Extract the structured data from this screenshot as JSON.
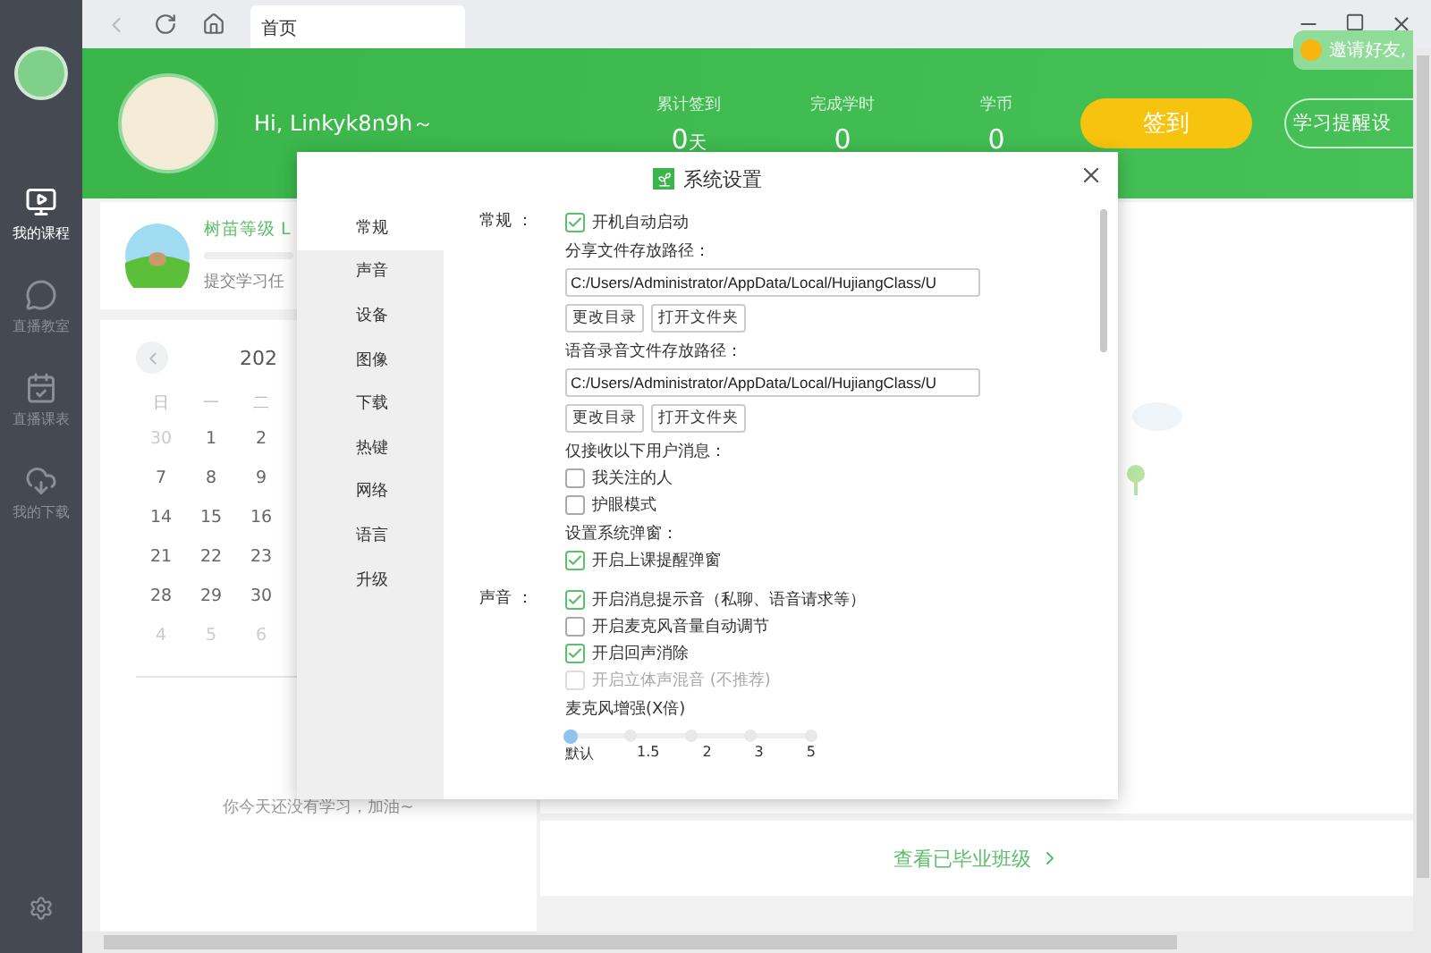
{
  "sidebar": {
    "items": [
      {
        "label": "我的课程",
        "selected": true
      },
      {
        "label": "直播教室",
        "selected": false
      },
      {
        "label": "直播课表",
        "selected": false
      },
      {
        "label": "我的下载",
        "selected": false
      }
    ]
  },
  "toolbar": {
    "tab": "首页"
  },
  "banner": {
    "greeting": "Hi, Linkyk8n9h～",
    "invite": "邀请好友,",
    "stats": [
      {
        "label": "累计签到",
        "value": "0",
        "unit": "天"
      },
      {
        "label": "完成学时",
        "value": "0"
      },
      {
        "label": "学币",
        "value": "0"
      }
    ],
    "checkin_button": "签到",
    "reminder_button": "学习提醒设"
  },
  "level_card": {
    "title": "树苗等级 L",
    "level": 0,
    "subtitle": "提交学习任"
  },
  "calendar": {
    "year": "202",
    "weekdays": [
      "日",
      "一",
      "二"
    ],
    "weeks": [
      [
        {
          "day": "30",
          "muted": true
        },
        {
          "day": "1",
          "muted": false
        },
        {
          "day": "2",
          "muted": false
        }
      ],
      [
        {
          "day": "7",
          "muted": false
        },
        {
          "day": "8",
          "muted": false
        },
        {
          "day": "9",
          "muted": false
        }
      ],
      [
        {
          "day": "14",
          "muted": false
        },
        {
          "day": "15",
          "muted": false
        },
        {
          "day": "16",
          "muted": false
        }
      ],
      [
        {
          "day": "21",
          "muted": false
        },
        {
          "day": "22",
          "muted": false
        },
        {
          "day": "23",
          "muted": false
        }
      ],
      [
        {
          "day": "28",
          "muted": false
        },
        {
          "day": "29",
          "muted": false
        },
        {
          "day": "30",
          "muted": false
        }
      ],
      [
        {
          "day": "4",
          "muted": true
        },
        {
          "day": "5",
          "muted": true
        },
        {
          "day": "6",
          "muted": true
        }
      ]
    ]
  },
  "empty_state": "你今天还没有学习，加油~",
  "graduated_link": "查看已毕业班级",
  "dialog": {
    "title": "系统设置",
    "nav": [
      {
        "label": "常规",
        "selected": true
      },
      {
        "label": "声音",
        "selected": false
      },
      {
        "label": "设备",
        "selected": false
      },
      {
        "label": "图像",
        "selected": false
      },
      {
        "label": "下载",
        "selected": false
      },
      {
        "label": "热键",
        "selected": false
      },
      {
        "label": "网络",
        "selected": false
      },
      {
        "label": "语言",
        "selected": false
      },
      {
        "label": "升级",
        "selected": false
      }
    ],
    "sections": [
      {
        "label": "常规 ：",
        "items": [
          {
            "kind": "checkbox",
            "label": "开机自动启动",
            "checked": true,
            "disabled": false
          },
          {
            "kind": "path",
            "label": "分享文件存放路径：",
            "value": "C:/Users/Administrator/AppData/Local/HujiangClass/U",
            "buttons": [
              "更改目录",
              "打开文件夹"
            ]
          },
          {
            "kind": "path",
            "label": "语音录音文件存放路径：",
            "value": "C:/Users/Administrator/AppData/Local/HujiangClass/U",
            "buttons": [
              "更改目录",
              "打开文件夹"
            ]
          },
          {
            "kind": "heading",
            "label": "仅接收以下用户消息："
          },
          {
            "kind": "checkbox",
            "label": "我关注的人",
            "checked": false,
            "disabled": false
          },
          {
            "kind": "checkbox",
            "label": "护眼模式",
            "checked": false,
            "disabled": false
          },
          {
            "kind": "heading",
            "label": "设置系统弹窗："
          },
          {
            "kind": "checkbox",
            "label": "开启上课提醒弹窗",
            "checked": true,
            "disabled": false
          }
        ]
      },
      {
        "label": "声音 ：",
        "items": [
          {
            "kind": "checkbox",
            "label": "开启消息提示音（私聊、语音请求等）",
            "checked": true,
            "disabled": false
          },
          {
            "kind": "checkbox",
            "label": "开启麦克风音量自动调节",
            "checked": false,
            "disabled": false
          },
          {
            "kind": "checkbox",
            "label": "开启回声消除",
            "checked": true,
            "disabled": false
          },
          {
            "kind": "checkbox",
            "label": "开启立体声混音 (不推荐)",
            "checked": false,
            "disabled": true
          },
          {
            "kind": "heading",
            "label": "麦克风增强(X倍)"
          },
          {
            "kind": "slider",
            "level": 0,
            "stops": [
              "默认",
              "1.5",
              "2",
              "3",
              "5"
            ]
          }
        ]
      }
    ]
  }
}
